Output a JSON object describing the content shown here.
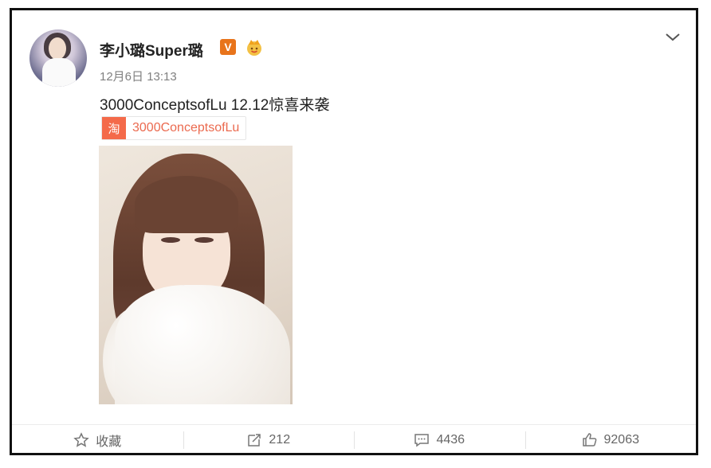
{
  "post": {
    "username": "李小璐Super璐",
    "verified_badge": "V",
    "timestamp": "12月6日 13:13",
    "text": "3000ConceptsofLu 12.12惊喜来袭",
    "shop_tag": {
      "icon_label": "淘",
      "label": "3000ConceptsofLu"
    },
    "icons": {
      "avatar": "avatar-photo",
      "crown": "crown-icon",
      "menu": "chevron-down-icon"
    }
  },
  "actions": {
    "favorite": {
      "label": "收藏",
      "icon": "star-icon"
    },
    "repost": {
      "count": "212",
      "icon": "repost-icon"
    },
    "comment": {
      "count": "4436",
      "icon": "comment-icon"
    },
    "like": {
      "count": "92063",
      "icon": "thumbs-up-icon"
    }
  },
  "colors": {
    "verified_badge": "#e8741b",
    "taobao": "#f46a4a",
    "shop_link": "#eb6a4f",
    "timestamp": "#808080",
    "action_text": "#666666"
  }
}
